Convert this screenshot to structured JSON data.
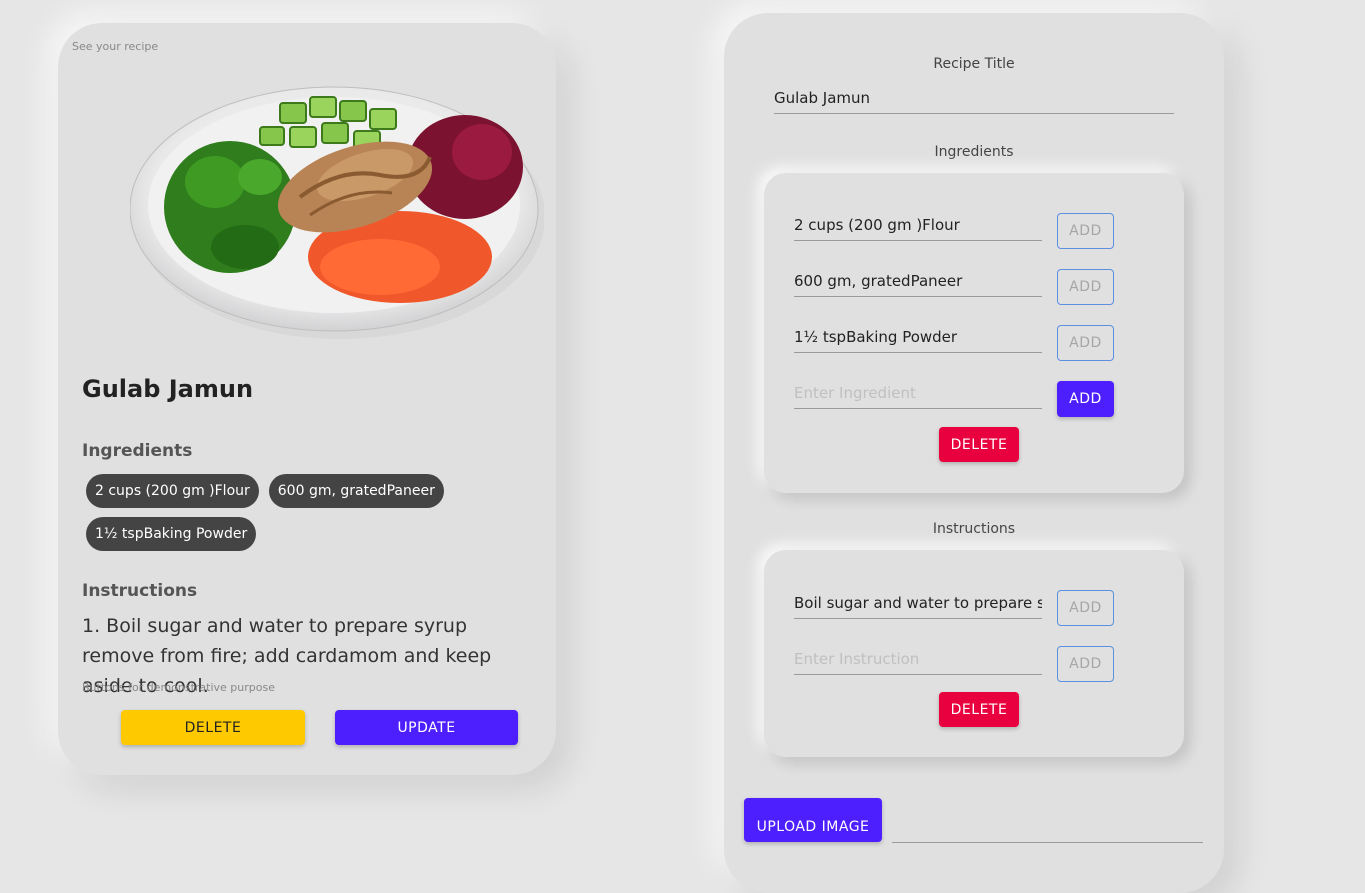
{
  "preview": {
    "caption": "See your recipe",
    "title": "Gulab Jamun",
    "ingredients_heading": "Ingredients",
    "ingredients": [
      "2 cups (200 gm )Flour",
      "600 gm, gratedPaneer",
      "1½ tspBaking Powder"
    ],
    "instructions_heading": "Instructions",
    "instruction_text": "1. Boil sugar and water to prepare syrup remove from fire; add cardamom and keep aside to cool.",
    "buttons_caption": "Buttons for demonstrative purpose",
    "delete_label": "DELETE",
    "update_label": "UPDATE"
  },
  "form": {
    "title_label": "Recipe Title",
    "title_value": "Gulab Jamun",
    "ingredients_label": "Ingredients",
    "ingredient_rows": [
      {
        "value": "2 cups (200 gm )Flour",
        "add_label": "ADD"
      },
      {
        "value": "600 gm, gratedPaneer",
        "add_label": "ADD"
      },
      {
        "value": "1½ tspBaking Powder",
        "add_label": "ADD"
      }
    ],
    "ingredient_placeholder": "Enter Ingredient",
    "ingredient_add_label": "ADD",
    "ingredient_delete_label": "DELETE",
    "instructions_label": "Instructions",
    "instruction_rows": [
      {
        "value": "Boil sugar and water to prepare syrup remove from fire; add cardamom and keep aside to cool.",
        "add_label": "ADD"
      }
    ],
    "instruction_placeholder": "Enter Instruction",
    "instruction_add_label": "ADD",
    "instruction_delete_label": "DELETE",
    "upload_label": "UPLOAD IMAGE"
  },
  "colors": {
    "primary": "#4d1fff",
    "danger": "#e8003f",
    "warning": "#ffc900",
    "chip": "#444444",
    "card": "#e0e0e0"
  },
  "icons": [
    "salad-bowl-image"
  ]
}
